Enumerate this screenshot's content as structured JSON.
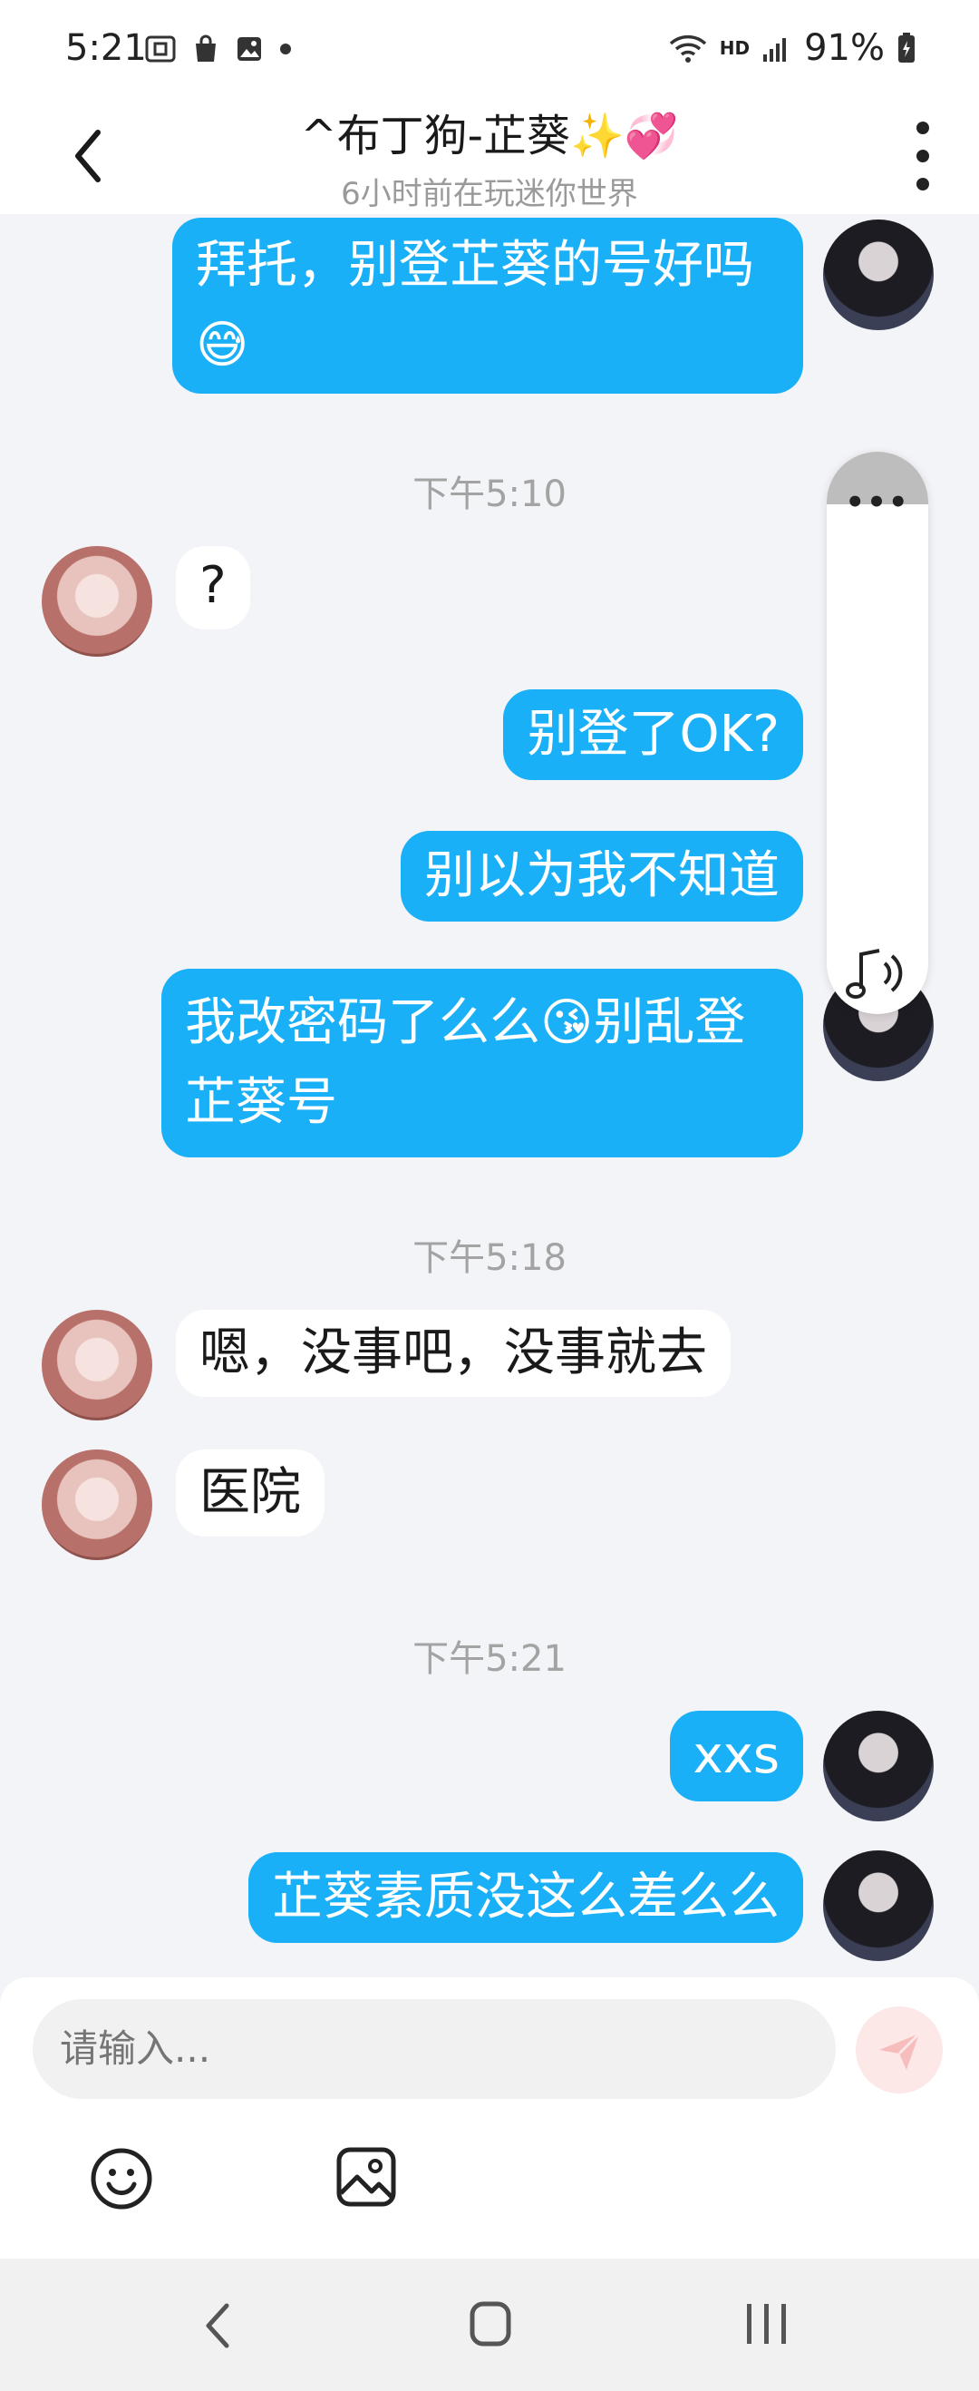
{
  "status_bar": {
    "time": "5:21",
    "battery": "91%",
    "network_label": "HD"
  },
  "header": {
    "title": "^布丁狗-芷葵✨💞",
    "subtitle": "6小时前在玩迷你世界"
  },
  "messages": [
    {
      "side": "out",
      "text": "拜托，别登芷葵的号好吗😅"
    },
    {
      "timestamp": "下午5:10"
    },
    {
      "side": "in",
      "text": "?"
    },
    {
      "side": "out",
      "text": "别登了OK?"
    },
    {
      "side": "out",
      "text": "别以为我不知道"
    },
    {
      "side": "out",
      "text": "我改密码了么么😘别乱登芷葵号"
    },
    {
      "timestamp": "下午5:18"
    },
    {
      "side": "in",
      "text": "嗯，没事吧，没事就去"
    },
    {
      "side": "in",
      "text": "医院"
    },
    {
      "timestamp": "下午5:21"
    },
    {
      "side": "out",
      "text": "xxs"
    },
    {
      "side": "out",
      "text": "芷葵素质没这么差么么"
    }
  ],
  "floating_panel": {
    "dots": "•••",
    "icon": "music-note-icon"
  },
  "input": {
    "placeholder": "请输入..."
  },
  "toolbar": {
    "icons": [
      "emoji-icon",
      "image-icon",
      "send-icon"
    ]
  },
  "colors": {
    "outgoing_bubble": "#1ab0f7",
    "incoming_bubble": "#ffffff",
    "background": "#f3f4f7",
    "send_button": "#fde8e8"
  }
}
